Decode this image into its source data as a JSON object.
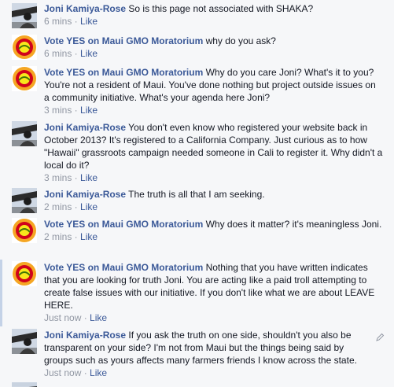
{
  "comments": [
    {
      "kind": "joni",
      "author": "Joni Kamiya-Rose",
      "text": "So is this page not associated with SHAKA?",
      "time": "6 mins",
      "sep": " · ",
      "like": "Like"
    },
    {
      "kind": "maui",
      "author": "Vote YES on Maui GMO Moratorium",
      "text": "why do you ask?",
      "time": "6 mins",
      "sep": " · ",
      "like": "Like"
    },
    {
      "kind": "maui",
      "author": "Vote YES on Maui GMO Moratorium",
      "text": "Why do you care Joni? What's it to you? You're not a resident of Maui. You've done nothing but project outside issues on a community initiative. What's your agenda here Joni?",
      "time": "3 mins",
      "sep": " · ",
      "like": "Like"
    },
    {
      "kind": "joni",
      "author": "Joni Kamiya-Rose",
      "text": "You don't even know who registered your website back in October 2013? It's registered to a California Company. Just curious as to how \"Hawaii\" grassroots campaign needed someone in Cali to register it. Why didn't a local do it?",
      "time": "3 mins",
      "sep": " · ",
      "like": "Like"
    },
    {
      "kind": "joni",
      "author": "Joni Kamiya-Rose",
      "text": "The truth is all that I am seeking.",
      "time": "2 mins",
      "sep": " · ",
      "like": "Like"
    },
    {
      "kind": "maui",
      "author": "Vote YES on Maui GMO Moratorium",
      "text": "Why does it matter? it's meaningless Joni.",
      "time": "2 mins",
      "sep": " · ",
      "like": "Like"
    },
    {
      "kind": "maui",
      "author": "Vote YES on Maui GMO Moratorium",
      "text": "Nothing that you have written indicates that you are looking for truth Joni. You are acting like a paid troll attempting to create false issues with our initiative. If you don't like what we are about LEAVE HERE.",
      "time": "Just now",
      "sep": " · ",
      "like": "Like"
    },
    {
      "kind": "joni",
      "author": "Joni Kamiya-Rose",
      "text": "If you ask the truth on one side, shouldn't you also be transparent on your side? I'm not from Maui but the things being said by groups such as yours affects many farmers friends I know across the state.",
      "time": "Just now",
      "sep": " · ",
      "like": "Like"
    }
  ]
}
